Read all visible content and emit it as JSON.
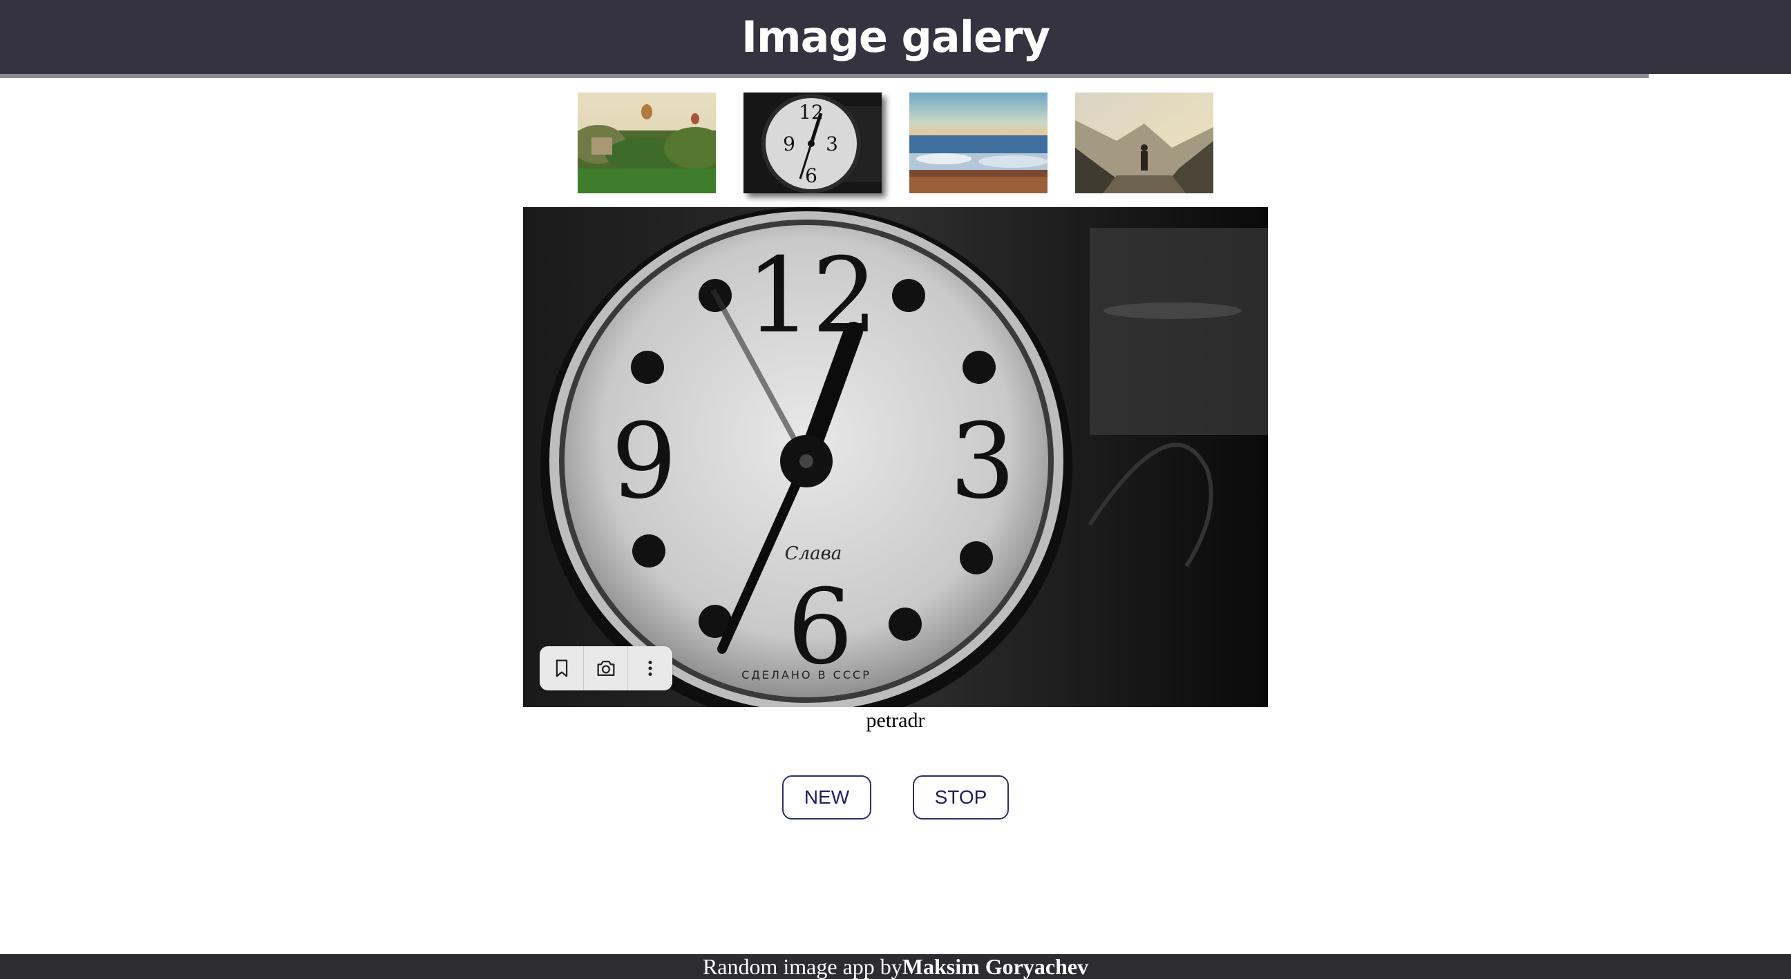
{
  "header": {
    "title": "Image galery"
  },
  "thumbnails": [
    {
      "name": "thumb-balloons",
      "active": false
    },
    {
      "name": "thumb-clock",
      "active": true
    },
    {
      "name": "thumb-sea",
      "active": false
    },
    {
      "name": "thumb-hiker",
      "active": false
    }
  ],
  "toolbar": {
    "icons": [
      "bookmark-icon",
      "camera-icon",
      "more-vertical-icon"
    ]
  },
  "main": {
    "author": "petradr"
  },
  "controls": {
    "new_label": "NEW",
    "stop_label": "STOP"
  },
  "footer": {
    "prefix": "Random image app by",
    "author": "Maksim Goryachev"
  },
  "colors": {
    "header_bg": "#35333f",
    "footer_bg": "#2d2c31",
    "button_text": "#1c1f63"
  }
}
